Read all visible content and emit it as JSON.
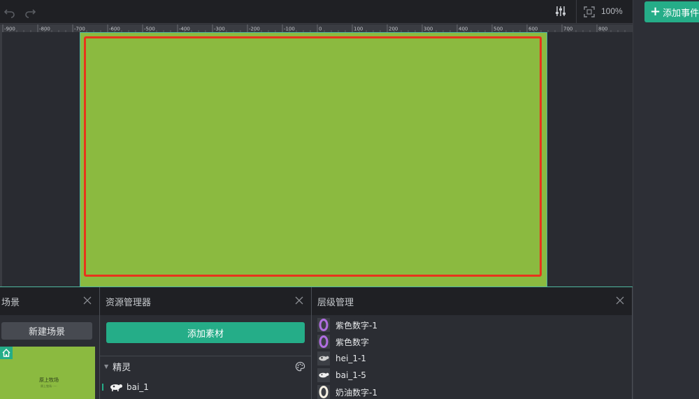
{
  "toolbar": {
    "zoom": "100%"
  },
  "right_panel": {
    "add_event_label": "添加事件"
  },
  "ruler": {
    "ticks": [
      "-900",
      "-800",
      "-700",
      "-600",
      "-500",
      "-400",
      "-300",
      "-200",
      "-100",
      "0",
      "100",
      "200",
      "300",
      "400",
      "500",
      "600",
      "700",
      "800"
    ]
  },
  "scene_panel": {
    "title": "场景",
    "new_scene_label": "新建场景",
    "thumb_title": "原上牧场",
    "thumb_sub": "原上牧场 ·····"
  },
  "resource_panel": {
    "title": "资源管理器",
    "add_asset_label": "添加素材",
    "section_label": "精灵",
    "items": [
      {
        "label": "bai_1"
      }
    ]
  },
  "layer_panel": {
    "title": "层级管理",
    "items": [
      {
        "label": "紫色数字-1",
        "icon": "purple-zero-icon"
      },
      {
        "label": "紫色数字",
        "icon": "purple-zero-icon"
      },
      {
        "label": "hei_1-1",
        "icon": "cow-icon"
      },
      {
        "label": "bai_1-5",
        "icon": "cow-icon"
      },
      {
        "label": "奶油数字-1",
        "icon": "cream-zero-icon"
      }
    ]
  },
  "colors": {
    "accent": "#25ad88",
    "canvas": "#8bba40",
    "selection": "#e8341c",
    "purple_digit": "#9b59d0"
  }
}
